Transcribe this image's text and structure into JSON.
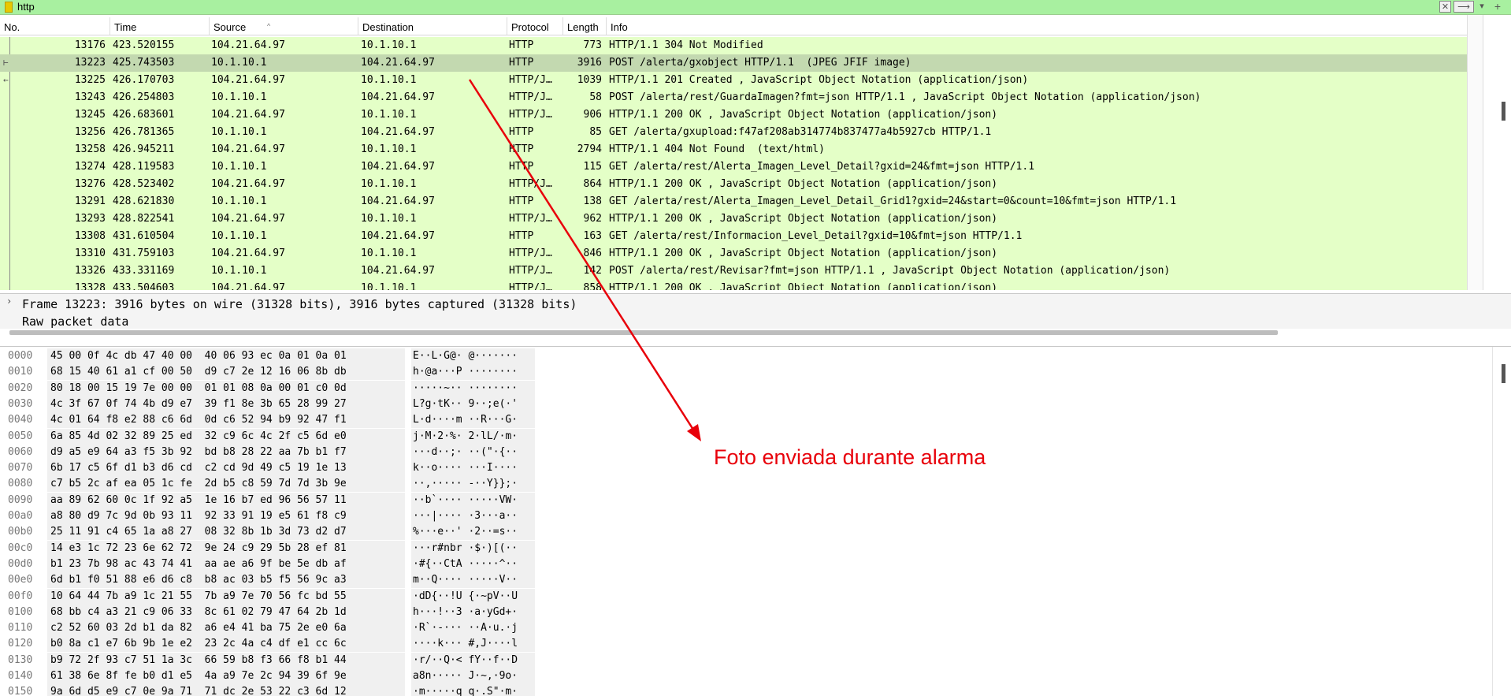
{
  "filter": {
    "value": "http",
    "clear_icon": "✕",
    "apply_icon": "⟶",
    "dropdown_icon": "▾",
    "add_icon": "+"
  },
  "packet_list": {
    "columns": [
      "No.",
      "Time",
      "Source",
      "Destination",
      "Protocol",
      "Length",
      "Info"
    ],
    "selected_no": "13223",
    "rows": [
      {
        "no": "13176",
        "time": "423.520155",
        "src": "104.21.64.97",
        "dst": "10.1.10.1",
        "proto": "HTTP",
        "len": "773",
        "info": "HTTP/1.1 304 Not Modified"
      },
      {
        "no": "13223",
        "time": "425.743503",
        "src": "10.1.10.1",
        "dst": "104.21.64.97",
        "proto": "HTTP",
        "len": "3916",
        "info": "POST /alerta/gxobject HTTP/1.1  (JPEG JFIF image)"
      },
      {
        "no": "13225",
        "time": "426.170703",
        "src": "104.21.64.97",
        "dst": "10.1.10.1",
        "proto": "HTTP/J…",
        "len": "1039",
        "info": "HTTP/1.1 201 Created , JavaScript Object Notation (application/json)"
      },
      {
        "no": "13243",
        "time": "426.254803",
        "src": "10.1.10.1",
        "dst": "104.21.64.97",
        "proto": "HTTP/J…",
        "len": "58",
        "info": "POST /alerta/rest/GuardaImagen?fmt=json HTTP/1.1 , JavaScript Object Notation (application/json)"
      },
      {
        "no": "13245",
        "time": "426.683601",
        "src": "104.21.64.97",
        "dst": "10.1.10.1",
        "proto": "HTTP/J…",
        "len": "906",
        "info": "HTTP/1.1 200 OK , JavaScript Object Notation (application/json)"
      },
      {
        "no": "13256",
        "time": "426.781365",
        "src": "10.1.10.1",
        "dst": "104.21.64.97",
        "proto": "HTTP",
        "len": "85",
        "info": "GET /alerta/gxupload:f47af208ab314774b837477a4b5927cb HTTP/1.1"
      },
      {
        "no": "13258",
        "time": "426.945211",
        "src": "104.21.64.97",
        "dst": "10.1.10.1",
        "proto": "HTTP",
        "len": "2794",
        "info": "HTTP/1.1 404 Not Found  (text/html)"
      },
      {
        "no": "13274",
        "time": "428.119583",
        "src": "10.1.10.1",
        "dst": "104.21.64.97",
        "proto": "HTTP",
        "len": "115",
        "info": "GET /alerta/rest/Alerta_Imagen_Level_Detail?gxid=24&fmt=json HTTP/1.1"
      },
      {
        "no": "13276",
        "time": "428.523402",
        "src": "104.21.64.97",
        "dst": "10.1.10.1",
        "proto": "HTTP/J…",
        "len": "864",
        "info": "HTTP/1.1 200 OK , JavaScript Object Notation (application/json)"
      },
      {
        "no": "13291",
        "time": "428.621830",
        "src": "10.1.10.1",
        "dst": "104.21.64.97",
        "proto": "HTTP",
        "len": "138",
        "info": "GET /alerta/rest/Alerta_Imagen_Level_Detail_Grid1?gxid=24&start=0&count=10&fmt=json HTTP/1.1"
      },
      {
        "no": "13293",
        "time": "428.822541",
        "src": "104.21.64.97",
        "dst": "10.1.10.1",
        "proto": "HTTP/J…",
        "len": "962",
        "info": "HTTP/1.1 200 OK , JavaScript Object Notation (application/json)"
      },
      {
        "no": "13308",
        "time": "431.610504",
        "src": "10.1.10.1",
        "dst": "104.21.64.97",
        "proto": "HTTP",
        "len": "163",
        "info": "GET /alerta/rest/Informacion_Level_Detail?gxid=10&fmt=json HTTP/1.1"
      },
      {
        "no": "13310",
        "time": "431.759103",
        "src": "104.21.64.97",
        "dst": "10.1.10.1",
        "proto": "HTTP/J…",
        "len": "846",
        "info": "HTTP/1.1 200 OK , JavaScript Object Notation (application/json)"
      },
      {
        "no": "13326",
        "time": "433.331169",
        "src": "10.1.10.1",
        "dst": "104.21.64.97",
        "proto": "HTTP/J…",
        "len": "142",
        "info": "POST /alerta/rest/Revisar?fmt=json HTTP/1.1 , JavaScript Object Notation (application/json)"
      },
      {
        "no": "13328",
        "time": "433.504603",
        "src": "104.21.64.97",
        "dst": "10.1.10.1",
        "proto": "HTTP/J…",
        "len": "858",
        "info": "HTTP/1.1 200 OK , JavaScript Object Notation (application/json)"
      }
    ]
  },
  "details": {
    "expand_icon": "›",
    "lines": [
      "Frame 13223: 3916 bytes on wire (31328 bits), 3916 bytes captured (31328 bits)",
      "Raw packet data"
    ]
  },
  "bytes": {
    "rows": [
      {
        "off": "0000",
        "hex": "45 00 0f 4c db 47 40 00  40 06 93 ec 0a 01 0a 01",
        "ascii": "E··L·G@· @·······"
      },
      {
        "off": "0010",
        "hex": "68 15 40 61 a1 cf 00 50  d9 c7 2e 12 16 06 8b db",
        "ascii": "h·@a···P ········"
      },
      {
        "off": "0020",
        "hex": "80 18 00 15 19 7e 00 00  01 01 08 0a 00 01 c0 0d",
        "ascii": "·····~·· ········"
      },
      {
        "off": "0030",
        "hex": "4c 3f 67 0f 74 4b d9 e7  39 f1 8e 3b 65 28 99 27",
        "ascii": "L?g·tK·· 9··;e(·'"
      },
      {
        "off": "0040",
        "hex": "4c 01 64 f8 e2 88 c6 6d  0d c6 52 94 b9 92 47 f1",
        "ascii": "L·d····m ··R···G·"
      },
      {
        "off": "0050",
        "hex": "6a 85 4d 02 32 89 25 ed  32 c9 6c 4c 2f c5 6d e0",
        "ascii": "j·M·2·%· 2·lL/·m·"
      },
      {
        "off": "0060",
        "hex": "d9 a5 e9 64 a3 f5 3b 92  bd b8 28 22 aa 7b b1 f7",
        "ascii": "···d··;· ··(\"·{··"
      },
      {
        "off": "0070",
        "hex": "6b 17 c5 6f d1 b3 d6 cd  c2 cd 9d 49 c5 19 1e 13",
        "ascii": "k··o···· ···I····"
      },
      {
        "off": "0080",
        "hex": "c7 b5 2c af ea 05 1c fe  2d b5 c8 59 7d 7d 3b 9e",
        "ascii": "··,····· -··Y}};·"
      },
      {
        "off": "0090",
        "hex": "aa 89 62 60 0c 1f 92 a5  1e 16 b7 ed 96 56 57 11",
        "ascii": "··b`···· ·····VW·"
      },
      {
        "off": "00a0",
        "hex": "a8 80 d9 7c 9d 0b 93 11  92 33 91 19 e5 61 f8 c9",
        "ascii": "···|···· ·3···a··"
      },
      {
        "off": "00b0",
        "hex": "25 11 91 c4 65 1a a8 27  08 32 8b 1b 3d 73 d2 d7",
        "ascii": "%···e··' ·2··=s··"
      },
      {
        "off": "00c0",
        "hex": "14 e3 1c 72 23 6e 62 72  9e 24 c9 29 5b 28 ef 81",
        "ascii": "···r#nbr ·$·)[(··"
      },
      {
        "off": "00d0",
        "hex": "b1 23 7b 98 ac 43 74 41  aa ae a6 9f be 5e db af",
        "ascii": "·#{··CtA ·····^··"
      },
      {
        "off": "00e0",
        "hex": "6d b1 f0 51 88 e6 d6 c8  b8 ac 03 b5 f5 56 9c a3",
        "ascii": "m··Q···· ·····V··"
      },
      {
        "off": "00f0",
        "hex": "10 64 44 7b a9 1c 21 55  7b a9 7e 70 56 fc bd 55",
        "ascii": "·dD{··!U {·~pV··U"
      },
      {
        "off": "0100",
        "hex": "68 bb c4 a3 21 c9 06 33  8c 61 02 79 47 64 2b 1d",
        "ascii": "h···!··3 ·a·yGd+·"
      },
      {
        "off": "0110",
        "hex": "c2 52 60 03 2d b1 da 82  a6 e4 41 ba 75 2e e0 6a",
        "ascii": "·R`·-··· ··A·u.·j"
      },
      {
        "off": "0120",
        "hex": "b0 8a c1 e7 6b 9b 1e e2  23 2c 4a c4 df e1 cc 6c",
        "ascii": "····k··· #,J····l"
      },
      {
        "off": "0130",
        "hex": "b9 72 2f 93 c7 51 1a 3c  66 59 b8 f3 66 f8 b1 44",
        "ascii": "·r/··Q·< fY··f··D"
      },
      {
        "off": "0140",
        "hex": "61 38 6e 8f fe b0 d1 e5  4a a9 7e 2c 94 39 6f 9e",
        "ascii": "a8n····· J·~,·9o·"
      },
      {
        "off": "0150",
        "hex": "9a 6d d5 e9 c7 0e 9a 71  71 dc 2e 53 22 c3 6d 12",
        "ascii": "·m·····q q·.S\"·m·"
      }
    ]
  },
  "annotation": {
    "text": "Foto enviada durante alarma",
    "color": "#e8000a"
  },
  "colors": {
    "http_row": "#e4ffc7",
    "selected_row": "#c3d9b0",
    "filter_ok": "#a8f0a0"
  }
}
